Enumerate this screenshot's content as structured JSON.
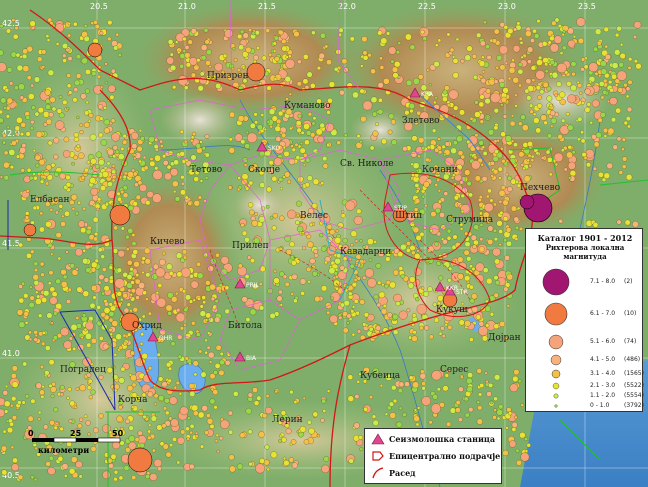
{
  "map": {
    "lon_ticks_top": [
      "20.5",
      "21.0",
      "21.5",
      "22.0",
      "22.5",
      "23.0",
      "23.5"
    ],
    "lat_ticks_left": [
      "42.5",
      "42.0",
      "41.5",
      "41.0",
      "40.5"
    ],
    "cities": [
      {
        "name": "Призрен"
      },
      {
        "name": "Куманово"
      },
      {
        "name": "Злетово"
      },
      {
        "name": "Скопје"
      },
      {
        "name": "Тетово"
      },
      {
        "name": "Св. Николе"
      },
      {
        "name": "Кочани"
      },
      {
        "name": "Велес"
      },
      {
        "name": "Штип"
      },
      {
        "name": "Кичево"
      },
      {
        "name": "Елбасан"
      },
      {
        "name": "Струмица"
      },
      {
        "name": "Кавадарци"
      },
      {
        "name": "Прилеп"
      },
      {
        "name": "Охрид"
      },
      {
        "name": "Битола"
      },
      {
        "name": "Кукуш"
      },
      {
        "name": "Лерин"
      },
      {
        "name": "Корча"
      },
      {
        "name": "Дојран"
      },
      {
        "name": "Поградец"
      },
      {
        "name": "Кубеица"
      },
      {
        "name": "Пехчево"
      },
      {
        "name": "Серес"
      }
    ],
    "stations": [
      "SKO",
      "KRA",
      "STIP",
      "PRIL",
      "OHR",
      "BIA",
      "STR",
      "KKR"
    ]
  },
  "legend": {
    "title": "Каталог 1901 - 2012",
    "subtitle": "Рихтерова локална магнитуда",
    "items": [
      {
        "range": "7.1 - 8.0",
        "count": "(2)",
        "color": "#a01670"
      },
      {
        "range": "6.1 - 7.0",
        "count": "(10)",
        "color": "#f07a40"
      },
      {
        "range": "5.1 - 6.0",
        "count": "(74)",
        "color": "#f5a37a"
      },
      {
        "range": "4.1 - 5.0",
        "count": "(486)",
        "color": "#f7b27e"
      },
      {
        "range": "3.1 - 4.0",
        "count": "(1565)",
        "color": "#f4c04a"
      },
      {
        "range": "2.1 - 3.0",
        "count": "(5522)",
        "color": "#e7e236"
      },
      {
        "range": "1.1 - 2.0",
        "count": "(5554)",
        "color": "#c9ec4a"
      },
      {
        "range": "0 - 1.0",
        "count": "(3792)",
        "color": "#98d84c"
      }
    ]
  },
  "key": {
    "station": "Сеизмолошка станица",
    "region": "Епицентрално подрачје",
    "fault": "Расед"
  },
  "scale": {
    "labels": [
      "0",
      "25",
      "50"
    ],
    "unit": "километри"
  },
  "colors": {
    "station": "#e0458f",
    "region": "#d01818",
    "fault": "#d01818"
  }
}
